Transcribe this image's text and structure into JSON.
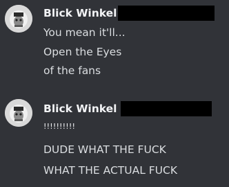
{
  "messages": [
    {
      "username": "Blick Winkel",
      "lines": [
        "You mean it'll...",
        "Open the Eyes",
        "of the fans"
      ]
    },
    {
      "username": "Blick Winkel",
      "lines": [
        "!!!!!!!!!!",
        "DUDE WHAT THE FUCK",
        "WHAT THE ACTUAL FUCK"
      ]
    }
  ],
  "colors": {
    "background": "#313338",
    "username": "#f2f3f5",
    "message_text": "#dbdee1",
    "redaction": "#000000"
  },
  "icons": {
    "avatar": "user-avatar-icon"
  }
}
